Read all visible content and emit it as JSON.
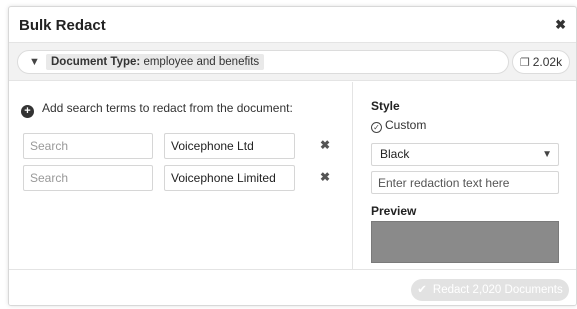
{
  "dialog": {
    "title": "Bulk Redact",
    "close_glyph": "✖"
  },
  "filter": {
    "filter_icon": "funnel-icon",
    "chip_key": "Document Type:",
    "chip_value": " employee and benefits",
    "count_icon": "documents-icon",
    "count": "2.02k"
  },
  "terms": {
    "add_label": "Add search terms to redact from the document:",
    "rows": [
      {
        "search_placeholder": "Search",
        "value": "Voicephone Ltd"
      },
      {
        "search_placeholder": "Search",
        "value": "Voicephone Limited"
      }
    ]
  },
  "style": {
    "label": "Style",
    "custom_label": "Custom",
    "color_options": [
      "Black"
    ],
    "color_selected": "Black",
    "redaction_placeholder": "Enter redaction text here",
    "preview_label": "Preview",
    "preview_color": "#8a8a8a"
  },
  "footer": {
    "redact_label": "Redact 2,020 Documents"
  }
}
